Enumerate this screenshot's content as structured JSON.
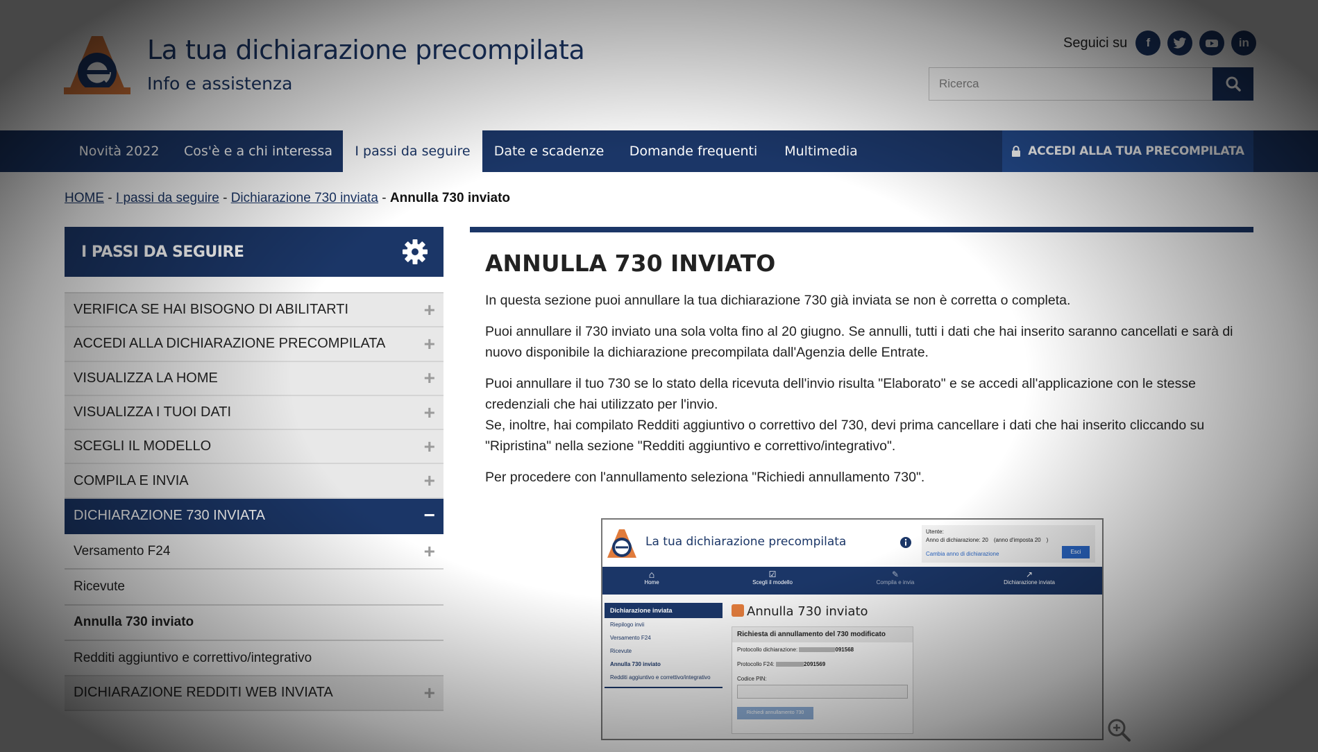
{
  "header": {
    "title": "La tua dichiarazione precompilata",
    "subtitle": "Info e assistenza",
    "follow_label": "Seguici su",
    "social": [
      {
        "icon": "facebook-icon",
        "glyph": "f"
      },
      {
        "icon": "twitter-icon",
        "glyph": "t"
      },
      {
        "icon": "youtube-icon",
        "glyph": "▶"
      },
      {
        "icon": "linkedin-icon",
        "glyph": "in"
      }
    ],
    "search_placeholder": "Ricerca"
  },
  "nav": {
    "items": [
      "Novità 2022",
      "Cos'è e a chi interessa",
      "I passi da seguire",
      "Date e scadenze",
      "Domande frequenti",
      "Multimedia"
    ],
    "active_index": 2,
    "login_label": "ACCEDI ALLA TUA PRECOMPILATA"
  },
  "breadcrumb": {
    "links": [
      "HOME",
      "I passi da seguire",
      "Dichiarazione 730 inviata"
    ],
    "current": "Annulla 730 inviato"
  },
  "sidebar": {
    "title": "I PASSI DA SEGUIRE",
    "items": [
      {
        "label": "VERIFICA SE HAI BISOGNO DI ABILITARTI",
        "type": "section",
        "toggle": "+"
      },
      {
        "label": "ACCEDI ALLA DICHIARAZIONE PRECOMPILATA",
        "type": "section",
        "toggle": "+"
      },
      {
        "label": "VISUALIZZA LA HOME",
        "type": "section",
        "toggle": "+"
      },
      {
        "label": "VISUALIZZA I TUOI DATI",
        "type": "section",
        "toggle": "+"
      },
      {
        "label": "SCEGLI IL MODELLO",
        "type": "section",
        "toggle": "+"
      },
      {
        "label": "COMPILA E INVIA",
        "type": "section",
        "toggle": "+"
      },
      {
        "label": "DICHIARAZIONE 730 INVIATA",
        "type": "active",
        "toggle": "−"
      },
      {
        "label": "Versamento F24",
        "type": "sub",
        "toggle": "+"
      },
      {
        "label": "Ricevute",
        "type": "sub",
        "toggle": ""
      },
      {
        "label": "Annulla 730 inviato",
        "type": "sub-bold",
        "toggle": ""
      },
      {
        "label": "Redditi aggiuntivo e correttivo/integrativo",
        "type": "sub",
        "toggle": ""
      },
      {
        "label": "DICHIARAZIONE REDDITI WEB INVIATA",
        "type": "section",
        "toggle": "+"
      }
    ]
  },
  "main": {
    "title": "ANNULLA 730 INVIATO",
    "p1": "In questa sezione puoi annullare la tua dichiarazione 730 già inviata se non è corretta o completa.",
    "p2": "Puoi annullare il 730 inviato una sola volta fino al 20 giugno. Se annulli, tutti i dati che hai inserito saranno cancellati e sarà di nuovo disponibile la dichiarazione precompilata dall'Agenzia delle Entrate.",
    "p3a": "Puoi annullare il tuo 730 se lo stato della ricevuta dell'invio risulta \"Elaborato\" e se accedi all'applicazione con le stesse credenziali che hai utilizzato per l'invio.",
    "p3b": "Se, inoltre, hai compilato Redditi aggiuntivo o correttivo del 730, devi prima cancellare i dati che hai inserito cliccando su \"Ripristina\" nella sezione \"Redditi aggiuntivo e correttivo/integrativo\".",
    "p4": "Per procedere con l'annullamento seleziona \"Richiedi annullamento 730\"."
  },
  "screenshot": {
    "title": "La tua dichiarazione precompilata",
    "user_label": "Utente:",
    "year_label": "Anno di dichiarazione: 20  (anno d'imposta 20  )",
    "change_year": "Cambia anno di dichiarazione",
    "exit": "Esci",
    "nav": [
      "Home",
      "Scegli il modello",
      "Compila e invia",
      "Dichiarazione inviata"
    ],
    "side_title": "Dichiarazione inviata",
    "side_items": [
      "Riepilogo invii",
      "Versamento F24",
      "Ricevute",
      "Annulla 730 inviato",
      "Redditi aggiuntivo e correttivo/integrativo"
    ],
    "panel_title": "Annulla 730 inviato",
    "box_title": "Richiesta di annullamento del 730 modificato",
    "protocol_label": "Protocollo dichiarazione:",
    "protocol_value": "091568",
    "f24_label": "Protocollo F24:",
    "f24_value": "2091569",
    "pin_label": "Codice PIN:",
    "button": "Richiedi annullamento 730"
  },
  "colors": {
    "primary": "#1b3667",
    "login": "#234a8c",
    "section_bg": "#e8e8e8"
  }
}
